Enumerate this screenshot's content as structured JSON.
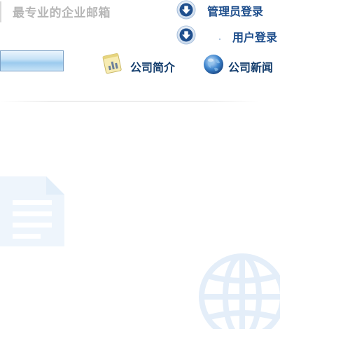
{
  "header": {
    "slogan": "最专业的企业邮箱"
  },
  "login": {
    "admin_label": "管理员登录",
    "user_label": "用户登录"
  },
  "nav": {
    "company_intro": "公司简介",
    "company_news": "公司新闻"
  },
  "colors": {
    "link": "#1e4e8c",
    "nav_text": "#123c6c",
    "slogan": "#b6b6b6",
    "watermark": "#e7f1fb"
  },
  "icons": {
    "admin": "down-arrow-circle-icon",
    "user": "down-arrow-circle-icon",
    "intro": "chart-notepad-icon",
    "news": "globe-icon",
    "decor_1": "document-watermark-icon",
    "decor_2": "globe-watermark-icon"
  }
}
